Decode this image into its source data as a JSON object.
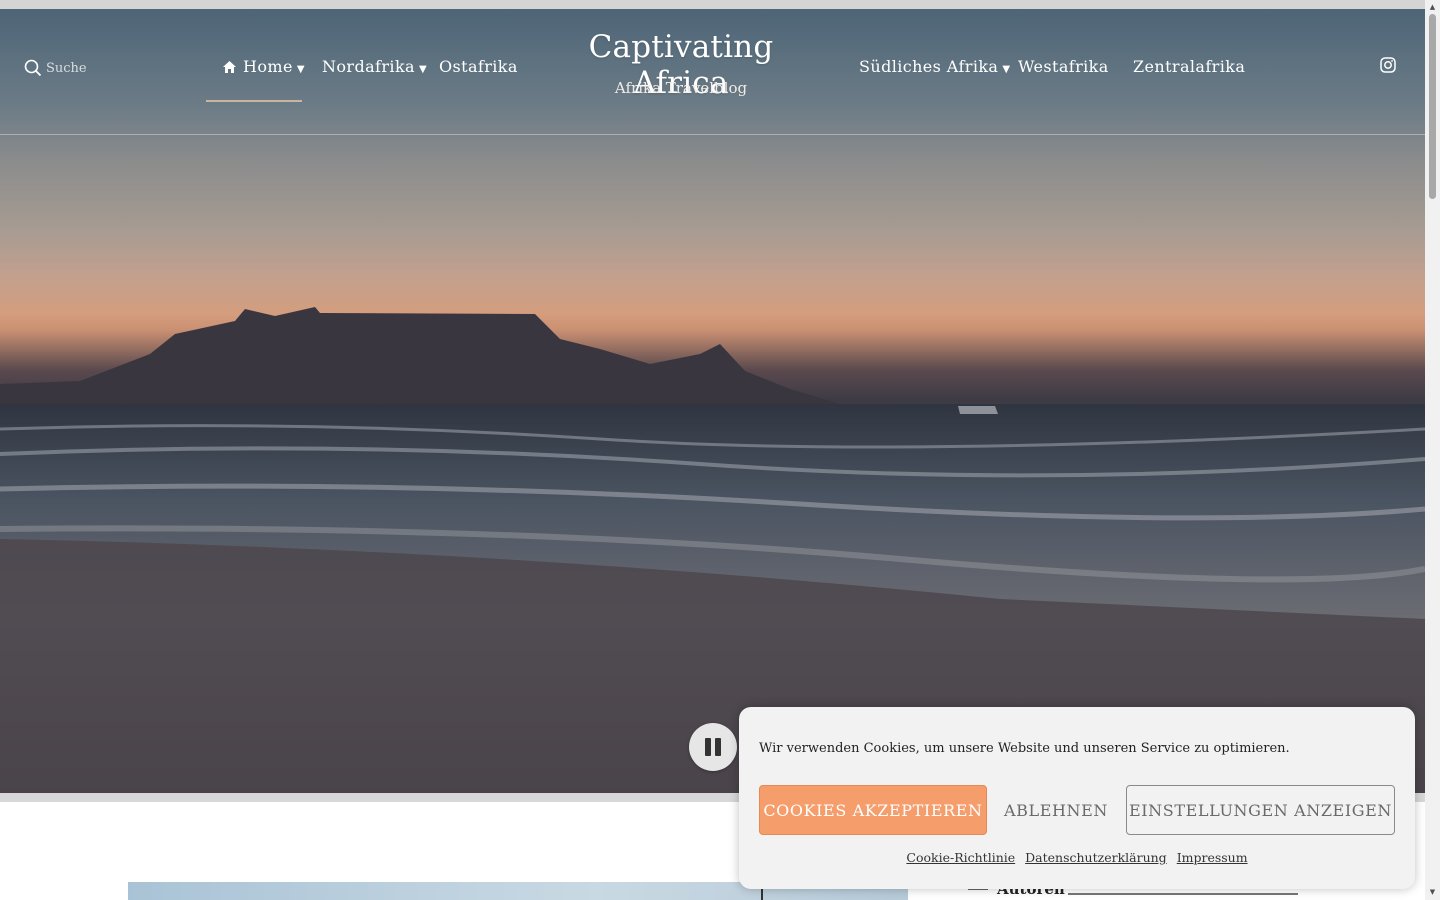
{
  "search": {
    "placeholder": "Suche"
  },
  "nav": {
    "left": [
      {
        "label": "Home",
        "has_dropdown": true,
        "active": true
      },
      {
        "label": "Nordafrika",
        "has_dropdown": true
      },
      {
        "label": "Ostafrika",
        "has_dropdown": false
      }
    ],
    "right": [
      {
        "label": "Südliches Afrika",
        "has_dropdown": true
      },
      {
        "label": "Westafrika",
        "has_dropdown": false
      },
      {
        "label": "Zentralafrika",
        "has_dropdown": false
      }
    ]
  },
  "site": {
    "title": "Captivating Africa",
    "subtitle": "Afrika Travelblog"
  },
  "social": {
    "icon": "instagram-icon"
  },
  "hero": {
    "control_icon": "pause-icon"
  },
  "sidebar": {
    "widget_title": "Autoren"
  },
  "cookie_banner": {
    "message": "Wir verwenden Cookies, um unsere Website und unseren Service zu optimieren.",
    "accept_label": "COOKIES AKZEPTIEREN",
    "deny_label": "ABLEHNEN",
    "settings_label": "EINSTELLUNGEN ANZEIGEN",
    "links": [
      "Cookie-Richtlinie",
      "Datenschutzerklärung",
      "Impressum"
    ],
    "accent_color": "#f59d6b"
  }
}
